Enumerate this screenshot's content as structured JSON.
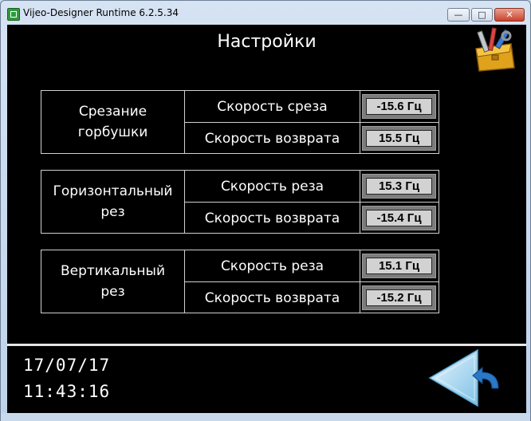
{
  "window": {
    "title": "Vijeo-Designer Runtime 6.2.5.34"
  },
  "screen": {
    "title": "Настройки"
  },
  "groups": [
    {
      "label": "Срезание\nгорбушки",
      "rows": [
        {
          "label": "Скорость среза",
          "value": "-15.6 Гц"
        },
        {
          "label": "Скорость возврата",
          "value": "15.5 Гц"
        }
      ]
    },
    {
      "label": "Горизонтальный\nрез",
      "rows": [
        {
          "label": "Скорость реза",
          "value": "15.3 Гц"
        },
        {
          "label": "Скорость возврата",
          "value": "-15.4 Гц"
        }
      ]
    },
    {
      "label": "Вертикальный\nрез",
      "rows": [
        {
          "label": "Скорость реза",
          "value": "15.1 Гц"
        },
        {
          "label": "Скорость возврата",
          "value": "-15.2 Гц"
        }
      ]
    }
  ],
  "status": {
    "date": "17/07/17",
    "time": "11:43:16"
  },
  "icons": {
    "settings": "toolbox-icon",
    "back": "back-arrow-icon"
  },
  "colors": {
    "background": "#000000",
    "value_field": "#d2d2d2",
    "back_arrow": "#a9d8f0"
  }
}
